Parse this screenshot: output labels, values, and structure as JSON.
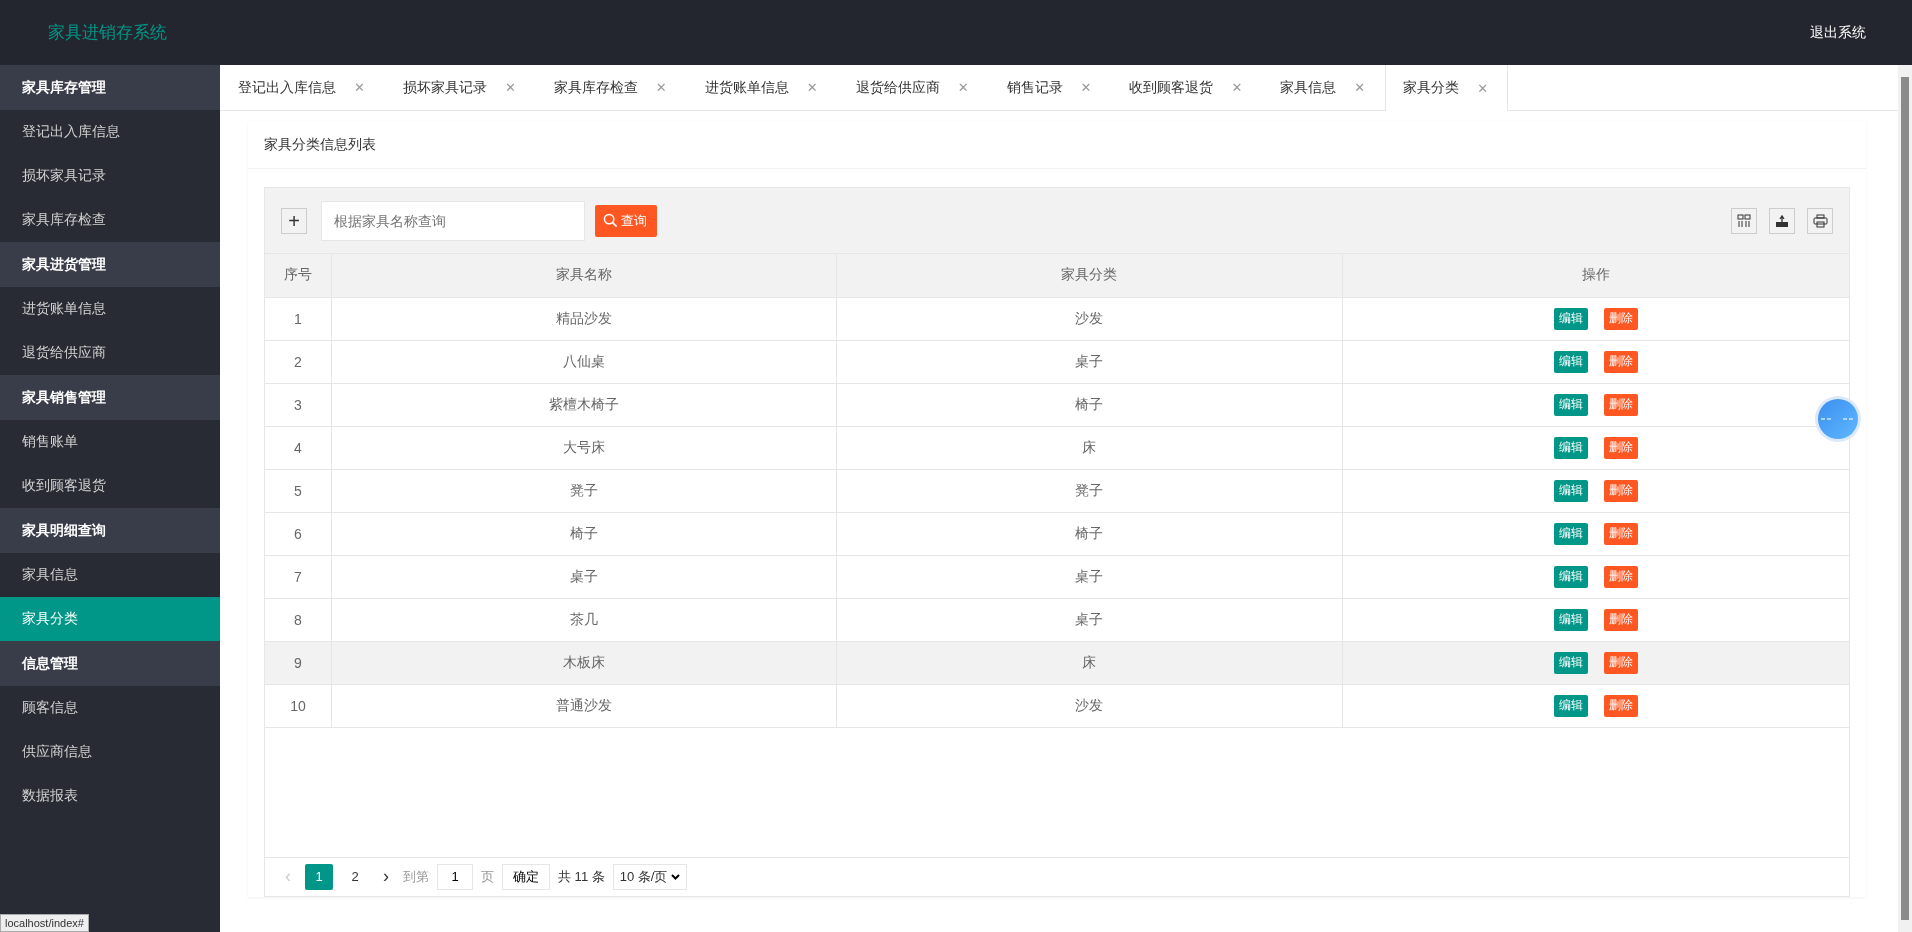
{
  "header": {
    "title": "家具进销存系统",
    "logout": "退出系统"
  },
  "sidebar": {
    "groups": [
      {
        "title": "家具库存管理",
        "items": [
          {
            "label": "登记出入库信息",
            "selected": false
          },
          {
            "label": "损坏家具记录",
            "selected": false
          },
          {
            "label": "家具库存检查",
            "selected": false
          }
        ]
      },
      {
        "title": "家具进货管理",
        "items": [
          {
            "label": "进货账单信息",
            "selected": false
          },
          {
            "label": "退货给供应商",
            "selected": false
          }
        ]
      },
      {
        "title": "家具销售管理",
        "items": [
          {
            "label": "销售账单",
            "selected": false
          },
          {
            "label": "收到顾客退货",
            "selected": false
          }
        ]
      },
      {
        "title": "家具明细查询",
        "items": [
          {
            "label": "家具信息",
            "selected": false
          },
          {
            "label": "家具分类",
            "selected": true
          }
        ]
      },
      {
        "title": "信息管理",
        "items": [
          {
            "label": "顾客信息",
            "selected": false
          },
          {
            "label": "供应商信息",
            "selected": false
          },
          {
            "label": "数据报表",
            "selected": false
          }
        ]
      }
    ]
  },
  "tabs": [
    {
      "label": "登记出入库信息",
      "close": "✕",
      "selected": false
    },
    {
      "label": "损坏家具记录",
      "close": "✕",
      "selected": false
    },
    {
      "label": "家具库存检查",
      "close": "✕",
      "selected": false
    },
    {
      "label": "进货账单信息",
      "close": "✕",
      "selected": false
    },
    {
      "label": "退货给供应商",
      "close": "✕",
      "selected": false
    },
    {
      "label": "销售记录",
      "close": "✕",
      "selected": false
    },
    {
      "label": "收到顾客退货",
      "close": "✕",
      "selected": false
    },
    {
      "label": "家具信息",
      "close": "✕",
      "selected": false
    },
    {
      "label": "家具分类",
      "close": "✕",
      "selected": true
    }
  ],
  "panel": {
    "title": "家具分类信息列表",
    "toolbar": {
      "add": "+",
      "search": {
        "placeholder": "根据家具名称查询"
      },
      "search_button": "查询"
    },
    "table": {
      "columns": [
        "序号",
        "家具名称",
        "家具分类",
        "操作"
      ],
      "rows": [
        {
          "no": "1",
          "name": "精品沙发",
          "category": "沙发",
          "edit": "编辑",
          "delete": "删除",
          "selected": false
        },
        {
          "no": "2",
          "name": "八仙桌",
          "category": "桌子",
          "edit": "编辑",
          "delete": "删除",
          "selected": false
        },
        {
          "no": "3",
          "name": "紫檀木椅子",
          "category": "椅子",
          "edit": "编辑",
          "delete": "删除",
          "selected": false
        },
        {
          "no": "4",
          "name": "大号床",
          "category": "床",
          "edit": "编辑",
          "delete": "删除",
          "selected": false
        },
        {
          "no": "5",
          "name": "凳子",
          "category": "凳子",
          "edit": "编辑",
          "delete": "删除",
          "selected": false
        },
        {
          "no": "6",
          "name": "椅子",
          "category": "椅子",
          "edit": "编辑",
          "delete": "删除",
          "selected": false
        },
        {
          "no": "7",
          "name": "桌子",
          "category": "桌子",
          "edit": "编辑",
          "delete": "删除",
          "selected": false
        },
        {
          "no": "8",
          "name": "茶几",
          "category": "桌子",
          "edit": "编辑",
          "delete": "删除",
          "selected": false
        },
        {
          "no": "9",
          "name": "木板床",
          "category": "床",
          "edit": "编辑",
          "delete": "删除",
          "selected": true
        },
        {
          "no": "10",
          "name": "普通沙发",
          "category": "沙发",
          "edit": "编辑",
          "delete": "删除",
          "selected": false
        }
      ]
    },
    "pagination": {
      "prev": "‹",
      "pages": [
        {
          "label": "1",
          "selected": true
        },
        {
          "label": "2",
          "selected": false
        }
      ],
      "next": "›",
      "goto_label": "到第",
      "goto_value": "1",
      "page_unit": "页",
      "confirm": "确定",
      "total": "共 11 条",
      "page_size": "10 条/页"
    }
  },
  "status_url": "localhost/index#"
}
